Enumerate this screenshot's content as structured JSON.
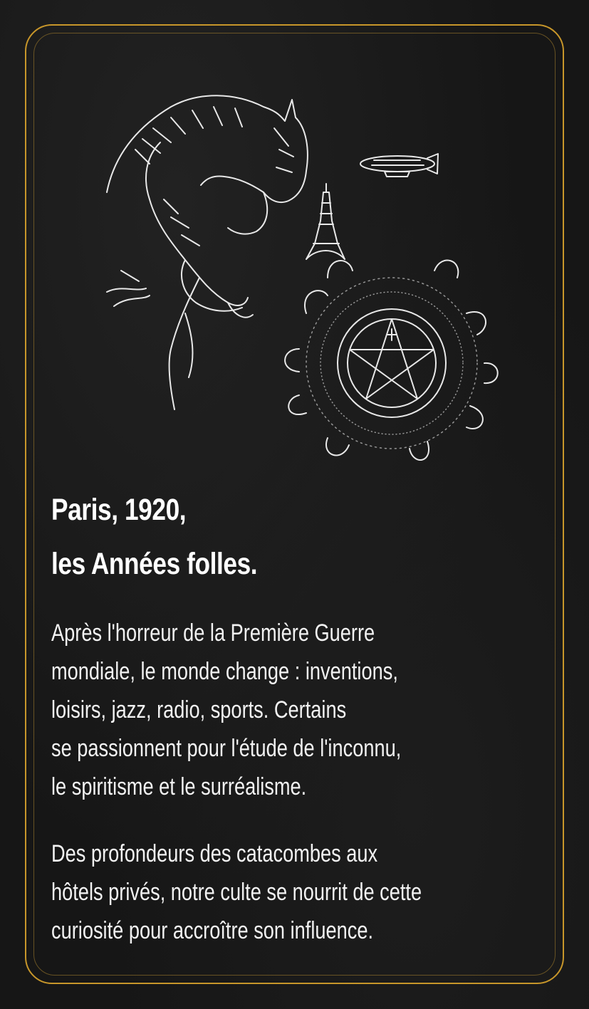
{
  "card": {
    "headline": [
      "Paris, 1920,",
      "les Années folles."
    ],
    "paragraph1": [
      "Après l'horreur de la Première Guerre",
      "mondiale, le monde change : inventions,",
      "loisirs, jazz, radio, sports. Certains",
      "se passionnent pour l'étude de l'inconnu,",
      "le spiritisme et le surréalisme."
    ],
    "paragraph2": [
      "Des profondeurs des catacombes aux",
      "hôtels privés, notre culte se nourrit de cette",
      "curiosité pour accroître son influence."
    ],
    "illustration_icons": [
      "gargoyle-icon",
      "eiffel-tower-icon",
      "zeppelin-icon",
      "pentagram-icon"
    ],
    "colors": {
      "background": "#161616",
      "frame": "#c7962a",
      "text": "#ffffff"
    }
  }
}
